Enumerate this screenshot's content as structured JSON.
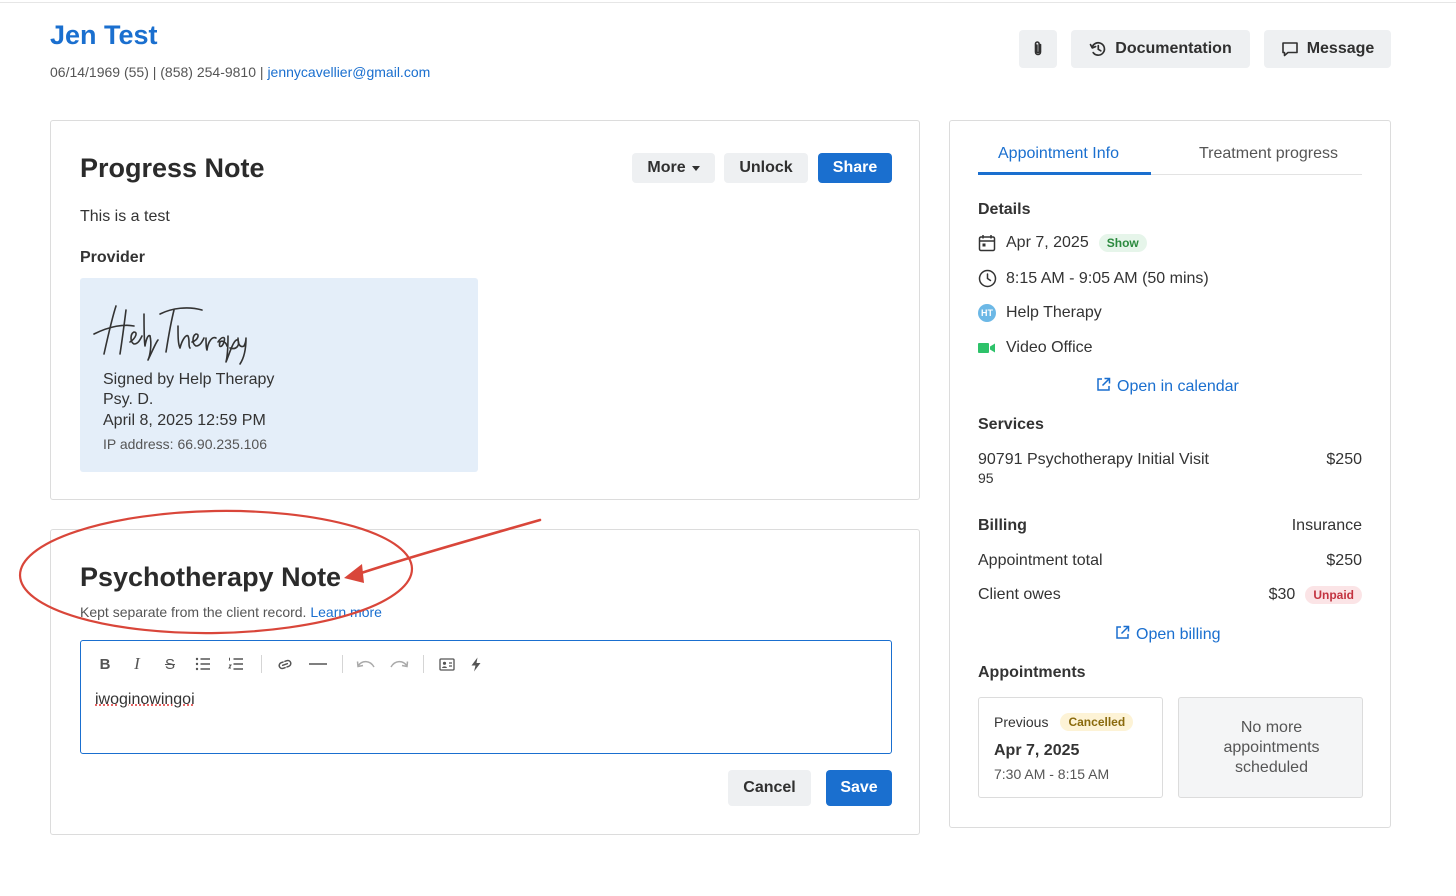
{
  "client": {
    "name": "Jen Test",
    "meta_prefix": "06/14/1969 (55) | (858) 254-9810 | ",
    "email": "jennycavellier@gmail.com"
  },
  "header_buttons": {
    "attachment_icon": "paperclip-icon",
    "documentation_label": "Documentation",
    "message_label": "Message"
  },
  "progress_note": {
    "title": "Progress Note",
    "more_label": "More",
    "unlock_label": "Unlock",
    "share_label": "Share",
    "body": "This is a test",
    "provider_label": "Provider",
    "signature": {
      "signed_by": "Signed by Help Therapy",
      "credential": "Psy. D.",
      "date": "April 8, 2025 12:59 PM",
      "ip": "IP address: 66.90.235.106"
    }
  },
  "psychotherapy_note": {
    "title": "Psychotherapy Note",
    "subtitle": "Kept separate from the client record.",
    "learn_more": "Learn more",
    "toolbar": [
      "bold-icon",
      "italic-icon",
      "strikethrough-icon",
      "bullet-list-icon",
      "numbered-list-icon",
      "link-icon",
      "horizontal-rule-icon",
      "undo-icon",
      "redo-icon",
      "contact-card-icon",
      "lightning-icon"
    ],
    "content": "iwoginowingoi",
    "cancel_label": "Cancel",
    "save_label": "Save"
  },
  "appointment_panel": {
    "tabs": [
      "Appointment Info",
      "Treatment progress"
    ],
    "active_tab": "Appointment Info",
    "details_label": "Details",
    "date": "Apr 7, 2025",
    "status_badge": "Show",
    "time": "8:15 AM - 9:05 AM (50 mins)",
    "provider_initials": "HT",
    "provider": "Help Therapy",
    "location": "Video Office",
    "open_calendar": "Open in calendar",
    "services_label": "Services",
    "service_name": "90791 Psychotherapy Initial Visit",
    "service_sub": "95",
    "service_price": "$250",
    "billing_label": "Billing",
    "billing_type": "Insurance",
    "appt_total_label": "Appointment total",
    "appt_total": "$250",
    "client_owes_label": "Client owes",
    "client_owes": "$30",
    "client_owes_badge": "Unpaid",
    "open_billing": "Open billing",
    "appointments_label": "Appointments",
    "previous": {
      "label": "Previous",
      "badge": "Cancelled",
      "date": "Apr 7, 2025",
      "time": "7:30 AM - 8:15 AM"
    },
    "no_more": "No more appointments scheduled"
  },
  "colors": {
    "accent": "#1a6fcf",
    "annotation": "#d9463a",
    "signature_bg": "#e4eef9",
    "video_green": "#2ec26a"
  }
}
